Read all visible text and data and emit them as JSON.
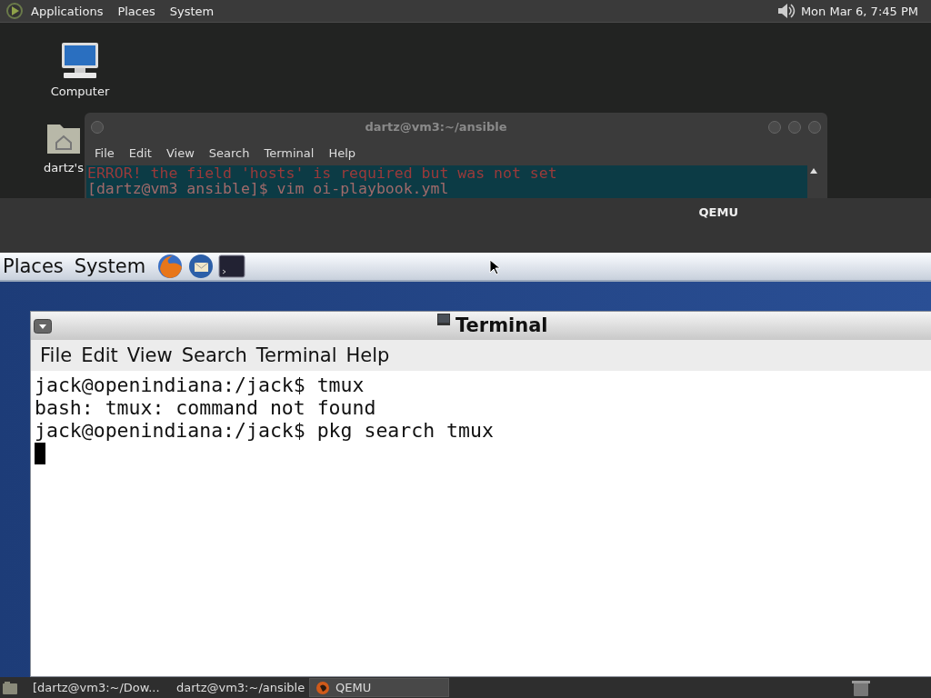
{
  "top_panel": {
    "menus": [
      "Applications",
      "Places",
      "System"
    ],
    "clock": "Mon Mar 6, 7:45 PM"
  },
  "desktop_icons": [
    {
      "kind": "computer",
      "label": "Computer"
    },
    {
      "kind": "home",
      "label": "dartz's"
    }
  ],
  "host_terminal": {
    "title": "dartz@vm3:~/ansible",
    "menus": [
      "File",
      "Edit",
      "View",
      "Search",
      "Terminal",
      "Help"
    ],
    "lines": [
      "ERROR! the field 'hosts' is required but was not set",
      "[dartz@vm3 ansible]$ vim oi-playbook.yml"
    ]
  },
  "qemu": {
    "title": "QEMU",
    "guest": {
      "panel_menus": [
        "Places",
        "System"
      ],
      "terminal": {
        "title": "Terminal",
        "menus": [
          "File",
          "Edit",
          "View",
          "Search",
          "Terminal",
          "Help"
        ],
        "lines": [
          "jack@openindiana:/jack$ tmux",
          "bash: tmux: command not found",
          "jack@openindiana:/jack$ pkg search tmux"
        ]
      }
    }
  },
  "taskbar": {
    "items": [
      {
        "kind": "terminal",
        "label": "[dartz@vm3:~/Dow...",
        "selected": false
      },
      {
        "kind": "terminal",
        "label": "dartz@vm3:~/ansible",
        "selected": false
      },
      {
        "kind": "qemu",
        "label": "QEMU",
        "selected": true
      }
    ]
  }
}
